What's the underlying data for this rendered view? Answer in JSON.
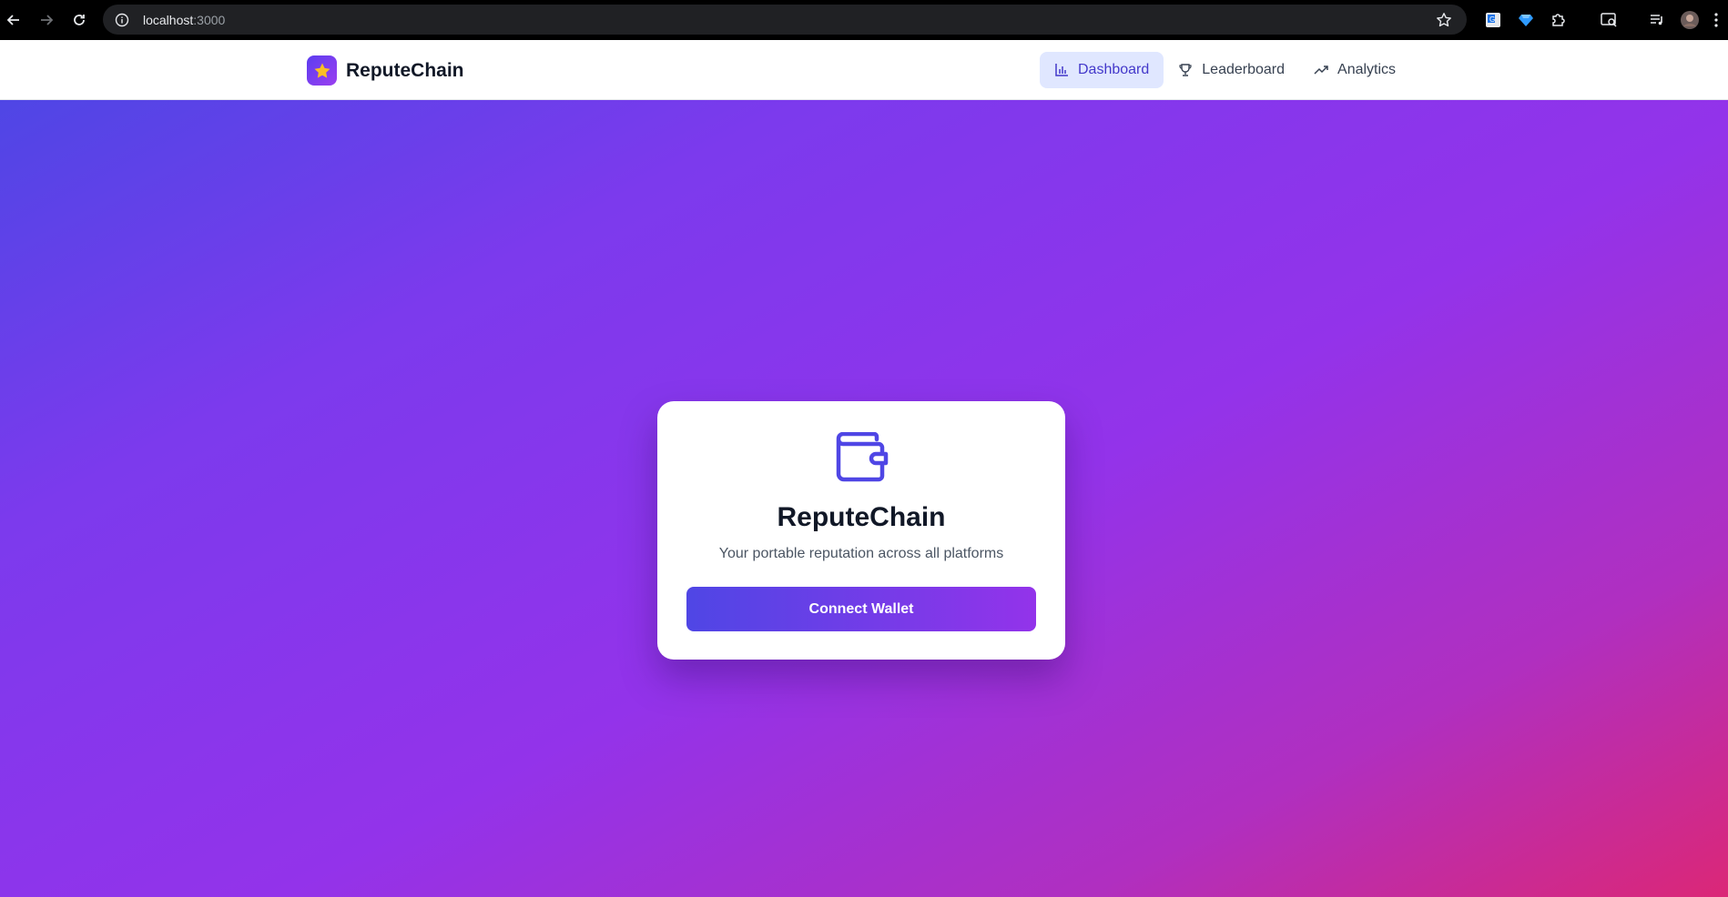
{
  "browser": {
    "url_host": "localhost",
    "url_port": ":3000"
  },
  "header": {
    "brand_name": "ReputeChain",
    "brand_icon": "star-icon",
    "nav": [
      {
        "label": "Dashboard",
        "icon": "bar-chart-icon",
        "active": true
      },
      {
        "label": "Leaderboard",
        "icon": "trophy-icon",
        "active": false
      },
      {
        "label": "Analytics",
        "icon": "trending-up-icon",
        "active": false
      }
    ]
  },
  "card": {
    "icon": "wallet-icon",
    "title": "ReputeChain",
    "subtitle": "Your portable reputation across all platforms",
    "button_label": "Connect Wallet"
  },
  "colors": {
    "accent": "#4f46e5",
    "accent_purple": "#9333ea",
    "gradient_end": "#db2777",
    "active_nav_bg": "#e0e7ff"
  }
}
